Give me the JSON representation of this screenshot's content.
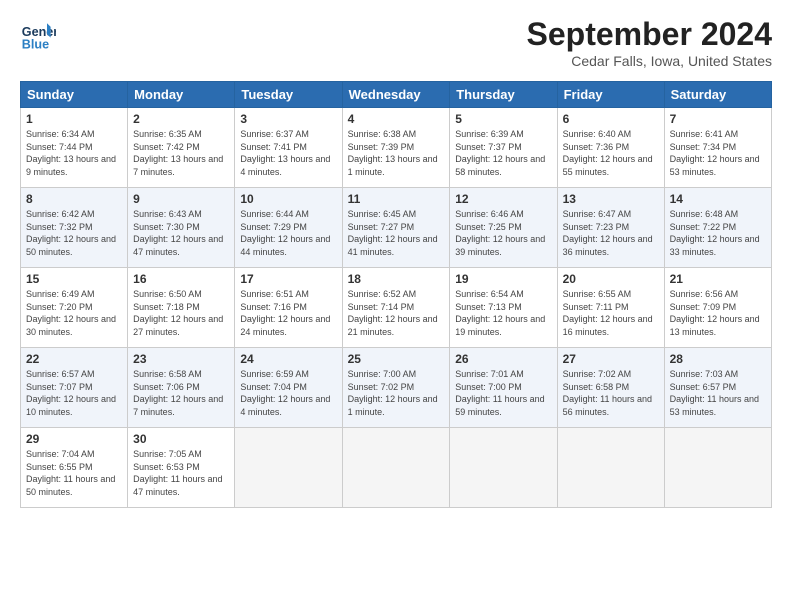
{
  "logo": {
    "line1": "General",
    "line2": "Blue"
  },
  "title": "September 2024",
  "location": "Cedar Falls, Iowa, United States",
  "days_of_week": [
    "Sunday",
    "Monday",
    "Tuesday",
    "Wednesday",
    "Thursday",
    "Friday",
    "Saturday"
  ],
  "weeks": [
    [
      {
        "num": "1",
        "rise": "6:34 AM",
        "set": "7:44 PM",
        "daylight": "13 hours and 9 minutes."
      },
      {
        "num": "2",
        "rise": "6:35 AM",
        "set": "7:42 PM",
        "daylight": "13 hours and 7 minutes."
      },
      {
        "num": "3",
        "rise": "6:37 AM",
        "set": "7:41 PM",
        "daylight": "13 hours and 4 minutes."
      },
      {
        "num": "4",
        "rise": "6:38 AM",
        "set": "7:39 PM",
        "daylight": "13 hours and 1 minute."
      },
      {
        "num": "5",
        "rise": "6:39 AM",
        "set": "7:37 PM",
        "daylight": "12 hours and 58 minutes."
      },
      {
        "num": "6",
        "rise": "6:40 AM",
        "set": "7:36 PM",
        "daylight": "12 hours and 55 minutes."
      },
      {
        "num": "7",
        "rise": "6:41 AM",
        "set": "7:34 PM",
        "daylight": "12 hours and 53 minutes."
      }
    ],
    [
      {
        "num": "8",
        "rise": "6:42 AM",
        "set": "7:32 PM",
        "daylight": "12 hours and 50 minutes."
      },
      {
        "num": "9",
        "rise": "6:43 AM",
        "set": "7:30 PM",
        "daylight": "12 hours and 47 minutes."
      },
      {
        "num": "10",
        "rise": "6:44 AM",
        "set": "7:29 PM",
        "daylight": "12 hours and 44 minutes."
      },
      {
        "num": "11",
        "rise": "6:45 AM",
        "set": "7:27 PM",
        "daylight": "12 hours and 41 minutes."
      },
      {
        "num": "12",
        "rise": "6:46 AM",
        "set": "7:25 PM",
        "daylight": "12 hours and 39 minutes."
      },
      {
        "num": "13",
        "rise": "6:47 AM",
        "set": "7:23 PM",
        "daylight": "12 hours and 36 minutes."
      },
      {
        "num": "14",
        "rise": "6:48 AM",
        "set": "7:22 PM",
        "daylight": "12 hours and 33 minutes."
      }
    ],
    [
      {
        "num": "15",
        "rise": "6:49 AM",
        "set": "7:20 PM",
        "daylight": "12 hours and 30 minutes."
      },
      {
        "num": "16",
        "rise": "6:50 AM",
        "set": "7:18 PM",
        "daylight": "12 hours and 27 minutes."
      },
      {
        "num": "17",
        "rise": "6:51 AM",
        "set": "7:16 PM",
        "daylight": "12 hours and 24 minutes."
      },
      {
        "num": "18",
        "rise": "6:52 AM",
        "set": "7:14 PM",
        "daylight": "12 hours and 21 minutes."
      },
      {
        "num": "19",
        "rise": "6:54 AM",
        "set": "7:13 PM",
        "daylight": "12 hours and 19 minutes."
      },
      {
        "num": "20",
        "rise": "6:55 AM",
        "set": "7:11 PM",
        "daylight": "12 hours and 16 minutes."
      },
      {
        "num": "21",
        "rise": "6:56 AM",
        "set": "7:09 PM",
        "daylight": "12 hours and 13 minutes."
      }
    ],
    [
      {
        "num": "22",
        "rise": "6:57 AM",
        "set": "7:07 PM",
        "daylight": "12 hours and 10 minutes."
      },
      {
        "num": "23",
        "rise": "6:58 AM",
        "set": "7:06 PM",
        "daylight": "12 hours and 7 minutes."
      },
      {
        "num": "24",
        "rise": "6:59 AM",
        "set": "7:04 PM",
        "daylight": "12 hours and 4 minutes."
      },
      {
        "num": "25",
        "rise": "7:00 AM",
        "set": "7:02 PM",
        "daylight": "12 hours and 1 minute."
      },
      {
        "num": "26",
        "rise": "7:01 AM",
        "set": "7:00 PM",
        "daylight": "11 hours and 59 minutes."
      },
      {
        "num": "27",
        "rise": "7:02 AM",
        "set": "6:58 PM",
        "daylight": "11 hours and 56 minutes."
      },
      {
        "num": "28",
        "rise": "7:03 AM",
        "set": "6:57 PM",
        "daylight": "11 hours and 53 minutes."
      }
    ],
    [
      {
        "num": "29",
        "rise": "7:04 AM",
        "set": "6:55 PM",
        "daylight": "11 hours and 50 minutes."
      },
      {
        "num": "30",
        "rise": "7:05 AM",
        "set": "6:53 PM",
        "daylight": "11 hours and 47 minutes."
      },
      null,
      null,
      null,
      null,
      null
    ]
  ]
}
